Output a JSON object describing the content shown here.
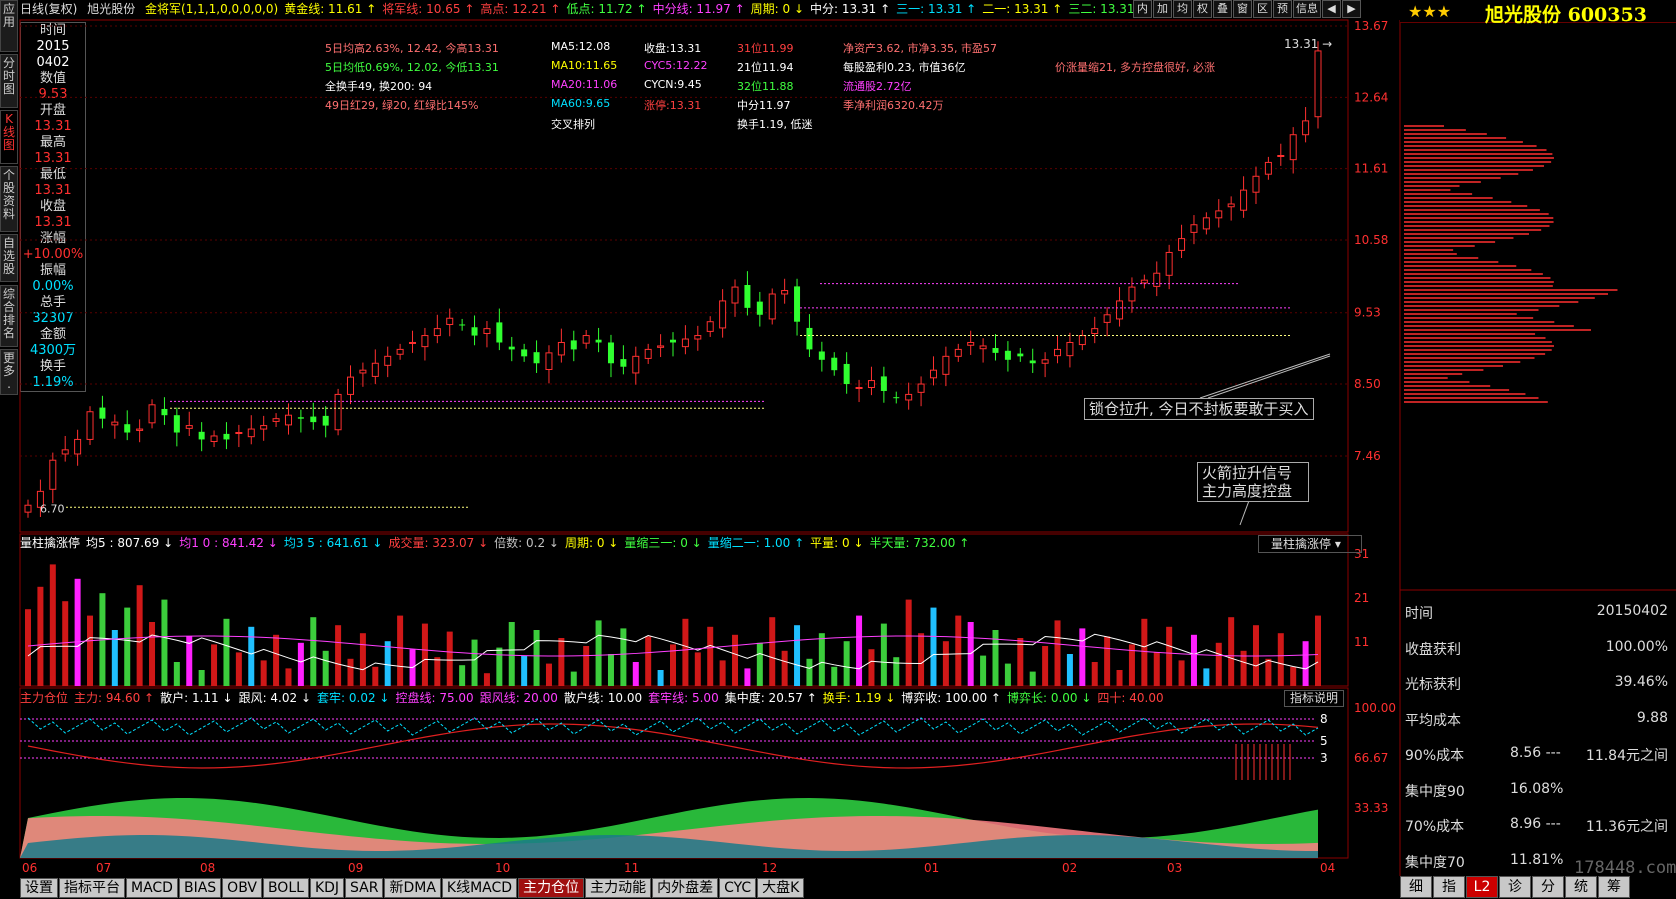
{
  "sidebar": [
    {
      "label": "应\n用",
      "active": false
    },
    {
      "label": "分\n时\n图",
      "active": false
    },
    {
      "label": "K\n线\n图",
      "active": true
    },
    {
      "label": "个\n股\n资\n料",
      "active": false
    },
    {
      "label": "自\n选\n股",
      "active": false
    },
    {
      "label": "综\n合\n排\n名",
      "active": false
    },
    {
      "label": "更\n多\n.",
      "active": false
    }
  ],
  "header": {
    "period": "日线(复权)",
    "stock": "旭光股份",
    "items": [
      {
        "text": "金将军(1,1,1,0,0,0,0,0)",
        "color": "#ffff00"
      },
      {
        "text": "黄金线: 11.61 ↑",
        "color": "#ffff00"
      },
      {
        "text": "将军线: 10.65 ↑",
        "color": "#ff4040"
      },
      {
        "text": "高点: 12.21 ↑",
        "color": "#ff4040"
      },
      {
        "text": "低点: 11.72 ↑",
        "color": "#40ff40"
      },
      {
        "text": "中分线: 11.97 ↑",
        "color": "#ff40ff"
      },
      {
        "text": "周期: 0 ↓",
        "color": "#ffff00"
      },
      {
        "text": "中分: 13.31 ↑",
        "color": "#ffffff"
      },
      {
        "text": "三一: 13.31 ↑",
        "color": "#00e0ff"
      },
      {
        "text": "二一: 13.31 ↑",
        "color": "#ffff00"
      },
      {
        "text": "三二: 13.31 ↑",
        "color": "#40ff40"
      }
    ],
    "buttons": [
      "内",
      "加",
      "均",
      "权",
      "叠",
      "窗",
      "区",
      "预",
      "信息",
      "◀",
      "▶"
    ]
  },
  "info": [
    {
      "label": "时间",
      "value": "2015",
      "cls": "wht"
    },
    {
      "label": "",
      "value": "0402",
      "cls": "wht"
    },
    {
      "label": "数值",
      "value": "9.53",
      "cls": "red"
    },
    {
      "label": "开盘",
      "value": "13.31",
      "cls": "red"
    },
    {
      "label": "最高",
      "value": "13.31",
      "cls": "red"
    },
    {
      "label": "最低",
      "value": "13.31",
      "cls": "red"
    },
    {
      "label": "收盘",
      "value": "13.31",
      "cls": "red"
    },
    {
      "label": "涨幅",
      "value": "+10.00%",
      "cls": "red"
    },
    {
      "label": "振幅",
      "value": "0.00%",
      "cls": "cyan"
    },
    {
      "label": "总手",
      "value": "32307",
      "cls": "cyan"
    },
    {
      "label": "金额",
      "value": "4300万",
      "cls": "cyan"
    },
    {
      "label": "换手",
      "value": "1.19%",
      "cls": "cyan"
    }
  ],
  "stats": {
    "col1": [
      "5日均高2.63%, 12.42, 今高13.31",
      "5日均低0.69%, 12.02, 今低13.31",
      "全换手49, 换200: 94",
      "49日红29, 绿20, 红绿比145%"
    ],
    "col2": [
      "MA5:12.08",
      "MA10:11.65",
      "MA20:11.06",
      "MA60:9.65",
      "交叉排列"
    ],
    "col3": [
      "收盘:13.31",
      "CYC5:12.22",
      "CYCN:9.45",
      "涨停:13.31"
    ],
    "col4": [
      "31位11.99",
      "21位11.94",
      "32位11.88",
      "中分11.97",
      "换手1.19, 低迷"
    ],
    "col5": [
      "净资产3.62, 市净3.35, 市盈57",
      "每股盈利0.23, 市值36亿",
      "流通股2.72亿",
      "季净利润6320.42万"
    ],
    "col6": "价涨量缩21, 多方控盘很好, 必涨"
  },
  "price_axis": [
    "13.67",
    "12.64",
    "11.61",
    "10.58",
    "9.53",
    "8.50",
    "7.46"
  ],
  "last_price": "13.31",
  "low_label": "6.70",
  "notes": {
    "lock": "锁仓拉升, 今日不封板要敢于买入",
    "rocket": "火箭拉升信号\n主力高度控盘"
  },
  "vol_bar": {
    "items": [
      {
        "text": "量柱擒涨停",
        "color": "#ffffff"
      },
      {
        "text": "均5 : 807.69 ↓",
        "color": "#ffffff"
      },
      {
        "text": "均1 0 : 841.42 ↓",
        "color": "#ff40ff"
      },
      {
        "text": "均3 5 : 641.61 ↓",
        "color": "#00e0ff"
      },
      {
        "text": "成交量: 323.07 ↓",
        "color": "#ff4040"
      },
      {
        "text": "倍数: 0.2 ↓",
        "color": "#c0c0c0"
      },
      {
        "text": "周期: 0 ↓",
        "color": "#ffff00"
      },
      {
        "text": "量缩三一: 0 ↓",
        "color": "#40ff40"
      },
      {
        "text": "量缩二一: 1.00 ↑",
        "color": "#00e0ff"
      },
      {
        "text": "平量: 0 ↓",
        "color": "#ffff00"
      },
      {
        "text": "半天量: 732.00 ↑",
        "color": "#40ff40"
      }
    ],
    "selector": "量柱擒涨停",
    "axis": [
      "31",
      "21",
      "11"
    ]
  },
  "ind_bar": {
    "items": [
      {
        "text": "主力仓位",
        "color": "#ff4040"
      },
      {
        "text": "主力: 94.60 ↑",
        "color": "#ff4040"
      },
      {
        "text": "散户: 1.11 ↓",
        "color": "#ffffff"
      },
      {
        "text": "跟风: 4.02 ↓",
        "color": "#ffffff"
      },
      {
        "text": "套牢: 0.02 ↓",
        "color": "#00e0ff"
      },
      {
        "text": "控盘线: 75.00",
        "color": "#ff40ff"
      },
      {
        "text": "跟风线: 20.00",
        "color": "#ff40ff"
      },
      {
        "text": "散户线: 10.00",
        "color": "#ffffff"
      },
      {
        "text": "套牢线: 5.00",
        "color": "#ff40ff"
      },
      {
        "text": "集中度: 20.57 ↑",
        "color": "#ffffff"
      },
      {
        "text": "换手: 1.19 ↓",
        "color": "#ffff00"
      },
      {
        "text": "博弈收: 100.00 ↑",
        "color": "#ffffff"
      },
      {
        "text": "博弈长: 0.00 ↓",
        "color": "#40ff40"
      },
      {
        "text": "四十: 40.00",
        "color": "#ff4040"
      }
    ],
    "help": "指标说明",
    "axis": [
      "100.00",
      "66.67",
      "33.33"
    ],
    "marks": [
      "8",
      "5",
      "3"
    ]
  },
  "x_axis": [
    "06",
    "07",
    "08",
    "09",
    "10",
    "11",
    "12",
    "01",
    "02",
    "03",
    "04"
  ],
  "bottom_tabs": [
    {
      "label": "设置",
      "active": false
    },
    {
      "label": "指标平台",
      "active": false
    },
    {
      "label": "MACD",
      "active": false
    },
    {
      "label": "BIAS",
      "active": false
    },
    {
      "label": "OBV",
      "active": false
    },
    {
      "label": "BOLL",
      "active": false
    },
    {
      "label": "KDJ",
      "active": false
    },
    {
      "label": "SAR",
      "active": false
    },
    {
      "label": "新DMA",
      "active": false
    },
    {
      "label": "K线MACD",
      "active": false
    },
    {
      "label": "主力仓位",
      "active": true
    },
    {
      "label": "主力动能",
      "active": false
    },
    {
      "label": "内外盘差",
      "active": false
    },
    {
      "label": "CYC",
      "active": false
    },
    {
      "label": "大盘K",
      "active": false
    }
  ],
  "right": {
    "stars": "★★★",
    "title": "旭光股份 600353",
    "rows": [
      {
        "k": "时间",
        "m": "",
        "v": "20150402"
      },
      {
        "k": "收盘获利",
        "m": "",
        "v": "100.00%"
      },
      {
        "k": "光标获利",
        "m": "",
        "v": "39.46%"
      },
      {
        "k": "平均成本",
        "m": "",
        "v": "9.88"
      },
      {
        "k": "90%成本",
        "m": "8.56 ---",
        "v": "11.84元之间"
      },
      {
        "k": "集中度90",
        "m": "16.08%",
        "v": ""
      },
      {
        "k": "70%成本",
        "m": "8.96 ---",
        "v": "11.36元之间"
      },
      {
        "k": "集中度70",
        "m": "11.81%",
        "v": ""
      }
    ],
    "tabs": [
      {
        "label": "细",
        "active": false
      },
      {
        "label": "指",
        "active": false
      },
      {
        "label": "L2",
        "active": true
      },
      {
        "label": "诊",
        "active": false
      },
      {
        "label": "分",
        "active": false
      },
      {
        "label": "统",
        "active": false
      },
      {
        "label": "筹",
        "active": false
      }
    ],
    "watermark": "178448.com"
  },
  "candles": [
    6.75,
    6.95,
    7.4,
    7.55,
    7.7,
    8.1,
    8.0,
    7.95,
    7.8,
    7.85,
    8.2,
    8.05,
    7.8,
    7.9,
    7.7,
    7.75,
    7.7,
    7.8,
    7.85,
    7.9,
    8.0,
    8.05,
    8.0,
    7.95,
    7.9,
    8.35,
    8.6,
    8.7,
    8.8,
    8.9,
    9.0,
    9.1,
    9.2,
    9.3,
    9.45,
    9.35,
    9.2,
    9.3,
    9.1,
    9.0,
    8.9,
    8.8,
    8.95,
    9.1,
    9.0,
    9.2,
    9.1,
    8.8,
    8.75,
    8.9,
    9.0,
    9.05,
    9.1,
    9.15,
    9.2,
    9.4,
    9.7,
    9.9,
    9.6,
    9.5,
    9.8,
    9.85,
    9.4,
    9.0,
    8.85,
    8.7,
    8.5,
    8.45,
    8.55,
    8.4,
    8.3,
    8.35,
    8.5,
    8.7,
    8.9,
    9.0,
    9.1,
    9.05,
    8.95,
    8.85,
    8.9,
    8.8,
    8.85,
    9.0,
    9.1,
    9.2,
    9.3,
    9.5,
    9.7,
    9.9,
    10.0,
    10.1,
    10.4,
    10.6,
    10.8,
    10.9,
    11.0,
    11.1,
    11.3,
    11.5,
    11.7,
    11.8,
    12.1,
    12.3,
    13.31
  ]
}
